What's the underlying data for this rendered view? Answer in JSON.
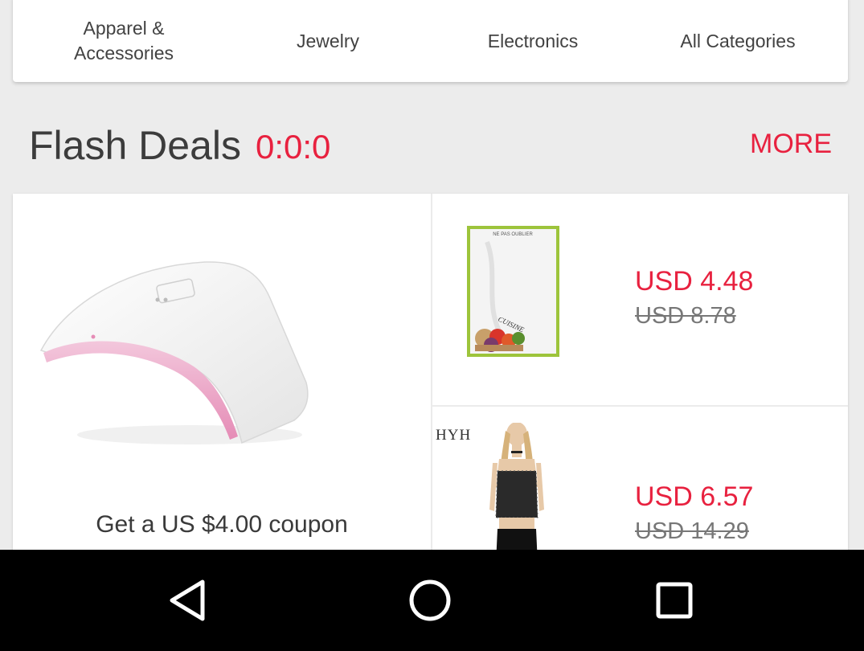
{
  "categories": [
    {
      "label": "Apparel & Accessories"
    },
    {
      "label": "Jewelry"
    },
    {
      "label": "Electronics"
    },
    {
      "label": "All Categories"
    }
  ],
  "flash_deals": {
    "title": "Flash Deals",
    "timer": "0:0:0",
    "more_label": "MORE"
  },
  "featured": {
    "icon": "uv-nail-lamp-image",
    "coupon_text": "Get a US $4.00 coupon"
  },
  "deals": [
    {
      "icon": "recipe-notebook-image",
      "cover_text": "NE PAS OUBLIER",
      "cover_title": "CUISINE",
      "price": "USD 4.48",
      "old_price": "USD 8.78"
    },
    {
      "icon": "lace-crop-top-image",
      "brand": "HYH",
      "price": "USD 6.57",
      "old_price": "USD 14.29"
    }
  ],
  "nav": [
    {
      "icon": "back-icon"
    },
    {
      "icon": "home-icon"
    },
    {
      "icon": "recents-icon"
    }
  ],
  "colors": {
    "accent": "#e8213f",
    "background": "#ececec",
    "card": "#ffffff"
  }
}
